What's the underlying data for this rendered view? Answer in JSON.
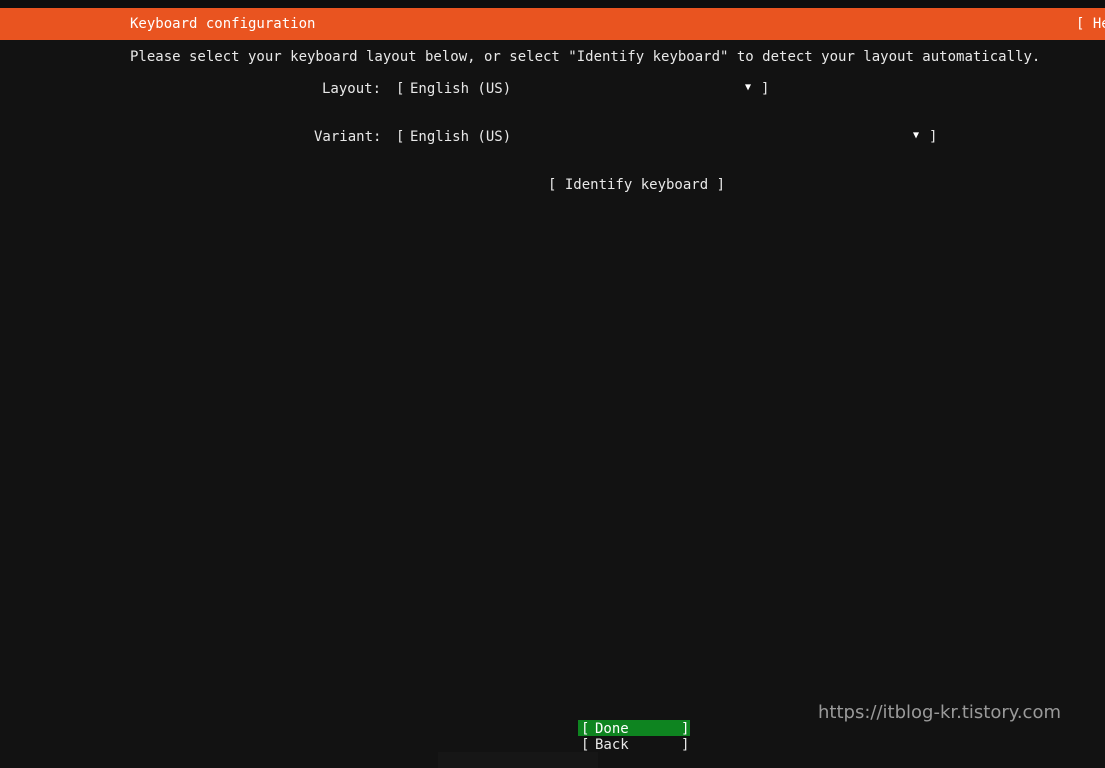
{
  "header": {
    "title": "Keyboard configuration",
    "help_label": "[ He"
  },
  "instructions": "Please select your keyboard layout below, or select \"Identify keyboard\" to detect your layout automatically.",
  "layout": {
    "label": "Layout:",
    "open_bracket": "[",
    "value": "English (US)",
    "arrow": "▼",
    "close_bracket": "]"
  },
  "variant": {
    "label": "Variant:",
    "open_bracket": "[",
    "value": "English (US)",
    "arrow": "▼",
    "close_bracket": "]"
  },
  "identify_button": "[ Identify keyboard ]",
  "buttons": {
    "done": {
      "open": "[",
      "label": "Done",
      "close": "]"
    },
    "back": {
      "open": "[",
      "label": "Back",
      "close": "]"
    }
  },
  "watermark": "https://itblog-kr.tistory.com",
  "colors": {
    "header_bg": "#e95420",
    "background": "#121212",
    "selected_button_bg": "#0e8420",
    "text": "#e8e8e8"
  }
}
